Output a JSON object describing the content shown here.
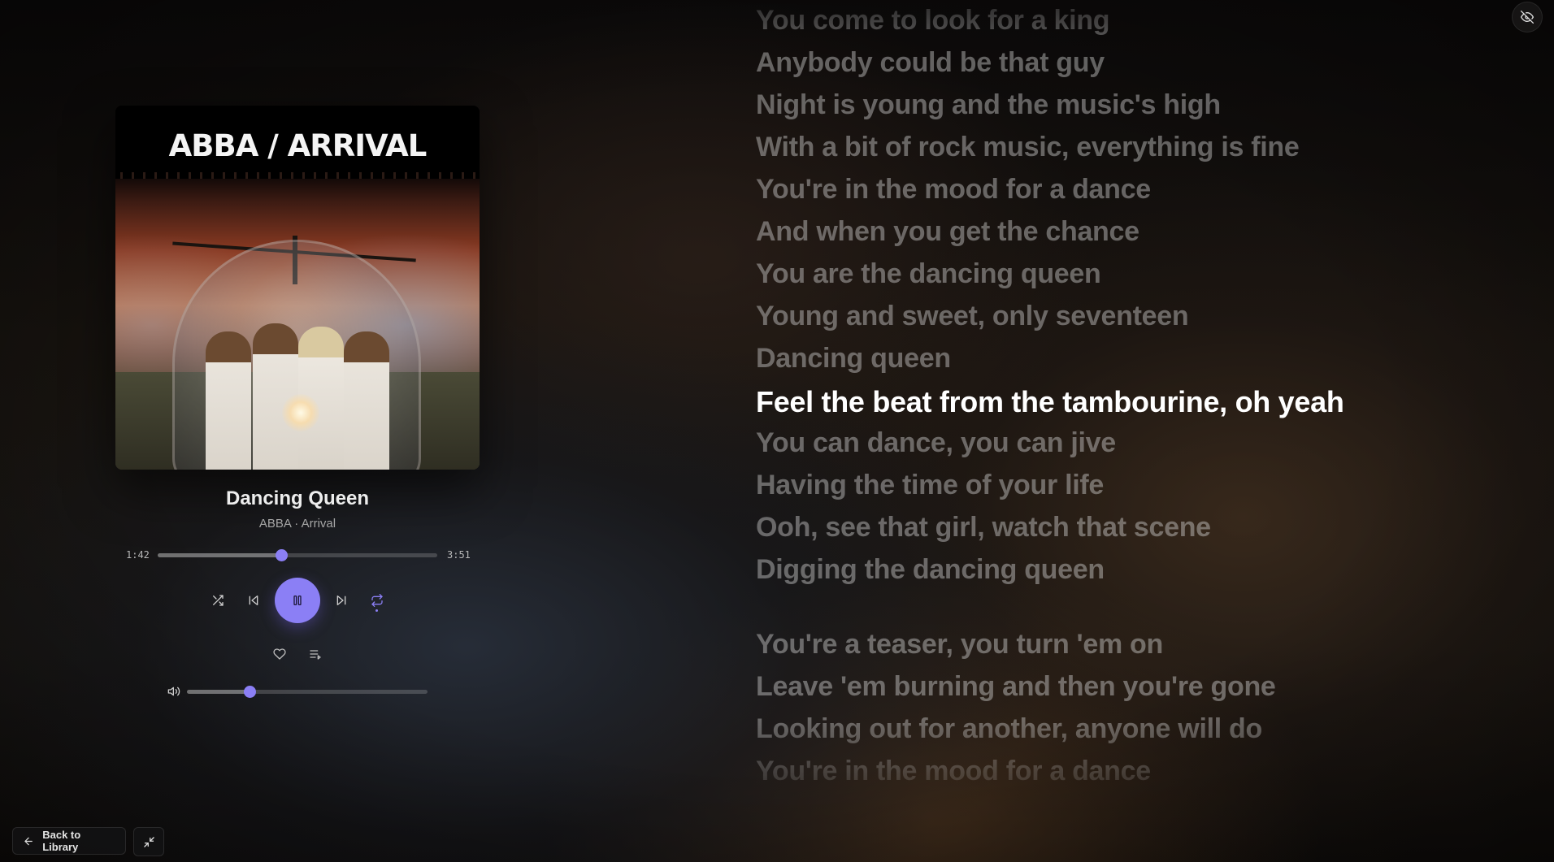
{
  "track": {
    "title": "Dancing Queen",
    "artist_album": "ABBA · Arrival",
    "album_cover_text": "ABBA / ARRIVAL",
    "current_time": "1:42",
    "duration": "3:51",
    "progress_fraction": 0.442,
    "volume_fraction": 0.26
  },
  "controls": {
    "shuffle_icon": "shuffle-icon",
    "previous_icon": "skip-previous-icon",
    "play_pause_icon": "pause-icon",
    "next_icon": "skip-next-icon",
    "repeat_icon": "repeat-icon",
    "like_icon": "heart-icon",
    "queue_icon": "queue-icon",
    "volume_icon": "volume-icon"
  },
  "lyrics": {
    "active_index": 9,
    "lines": [
      "You come to look for a king",
      "Anybody could be that guy",
      "Night is young and the music's high",
      "With a bit of rock music, everything is fine",
      "You're in the mood for a dance",
      "And when you get the chance",
      "You are the dancing queen",
      "Young and sweet, only seventeen",
      "Dancing queen",
      "Feel the beat from the tambourine, oh yeah",
      "You can dance, you can jive",
      "Having the time of your life",
      "Ooh, see that girl, watch that scene",
      "Digging the dancing queen",
      "You're a teaser, you turn 'em on",
      "Leave 'em burning and then you're gone",
      "Looking out for another, anyone will do",
      "You're in the mood for a dance"
    ]
  },
  "footer": {
    "back_label": "Back to Library"
  },
  "colors": {
    "accent": "#8b7ff5",
    "lyric_active": "#ffffff",
    "lyric_inactive": "#dcdcdc"
  }
}
